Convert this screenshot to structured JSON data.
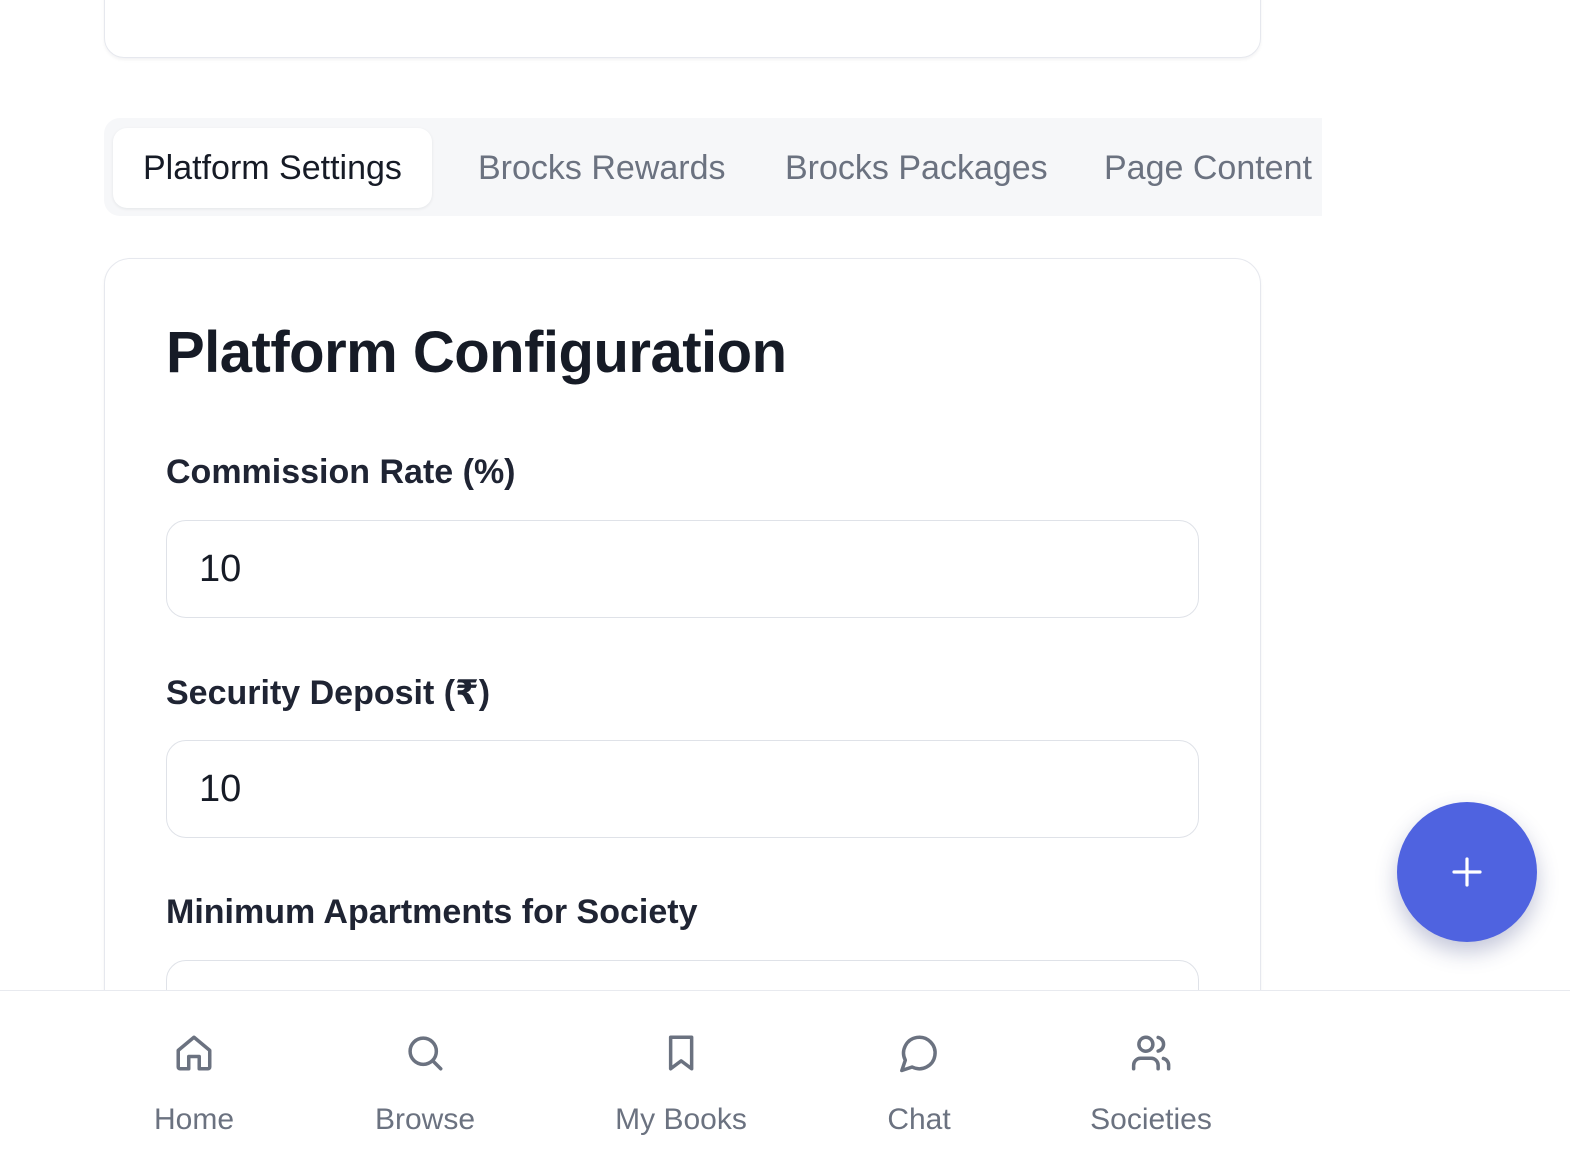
{
  "tabs": [
    {
      "label": "Platform Settings",
      "active": true
    },
    {
      "label": "Brocks Rewards",
      "active": false
    },
    {
      "label": "Brocks Packages",
      "active": false
    },
    {
      "label": "Page Content",
      "active": false
    }
  ],
  "config": {
    "title": "Platform Configuration",
    "fields": [
      {
        "label": "Commission Rate (%)",
        "value": "10"
      },
      {
        "label": "Security Deposit (₹)",
        "value": "10"
      },
      {
        "label": "Minimum Apartments for Society",
        "value": ""
      }
    ]
  },
  "fab": {
    "icon": "plus-icon"
  },
  "nav": [
    {
      "label": "Home",
      "icon": "home-icon"
    },
    {
      "label": "Browse",
      "icon": "search-icon"
    },
    {
      "label": "My Books",
      "icon": "bookmark-icon"
    },
    {
      "label": "Chat",
      "icon": "chat-bubble-icon"
    },
    {
      "label": "Societies",
      "icon": "users-icon"
    }
  ],
  "colors": {
    "accent": "#4f63e0",
    "muted_text": "#6b7280",
    "heading_text": "#161b26"
  }
}
